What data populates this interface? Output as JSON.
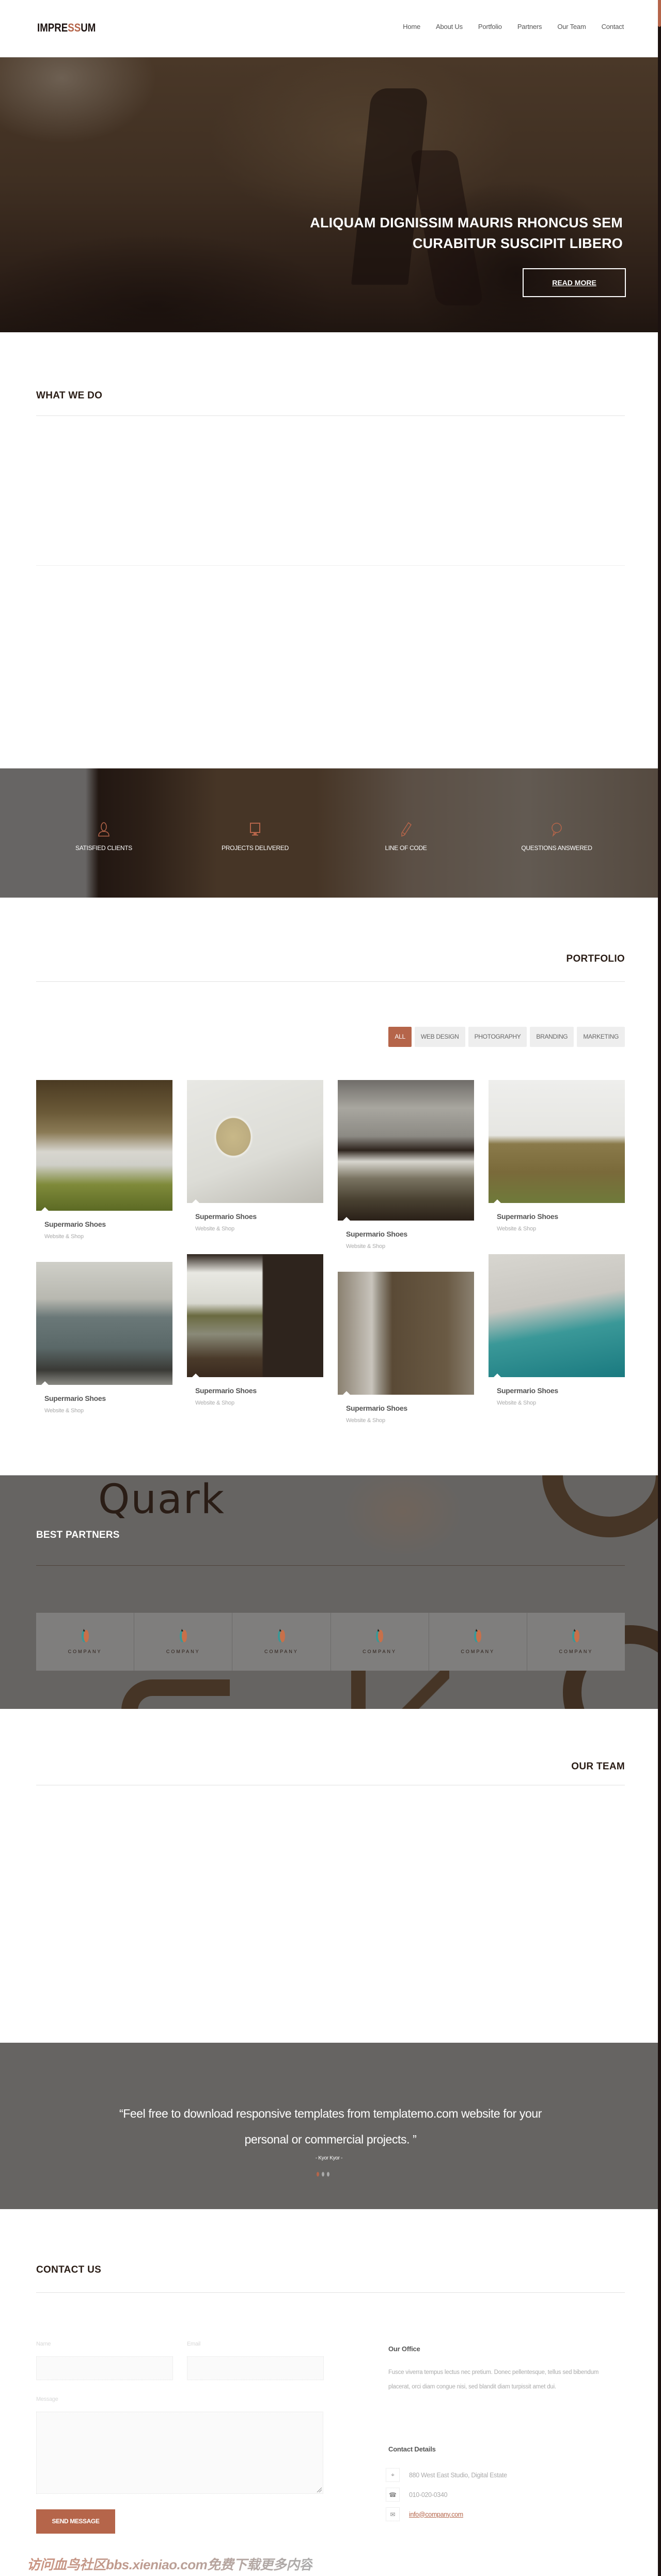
{
  "header": {
    "logo_prefix": "IMPRE",
    "logo_accent": "SS",
    "logo_suffix": "UM",
    "nav": [
      "Home",
      "About Us",
      "Portfolio",
      "Partners",
      "Our Team",
      "Contact"
    ]
  },
  "hero": {
    "title_line1": "ALIQUAM DIGNISSIM MAURIS RHONCUS SEM",
    "title_line2": "CURABITUR SUSCIPIT LIBERO",
    "button": "READ MORE",
    "prev_icon": "arrow-left-icon",
    "next_icon": "arrow-right-icon"
  },
  "what_we_do": {
    "title": "WHAT WE DO"
  },
  "stats": [
    {
      "icon": "user-icon",
      "label": "SATISFIED CLIENTS"
    },
    {
      "icon": "monitor-icon",
      "label": "PROJECTS DELIVERED"
    },
    {
      "icon": "pencil-icon",
      "label": "LINE OF CODE"
    },
    {
      "icon": "speech-bubble-icon",
      "label": "QUESTIONS ANSWERED"
    }
  ],
  "portfolio": {
    "title": "PORTFOLIO",
    "filters": [
      "ALL",
      "WEB DESIGN",
      "PHOTOGRAPHY",
      "BRANDING",
      "MARKETING"
    ],
    "active_filter": "ALL",
    "items": [
      {
        "title": "Supermario Shoes",
        "subtitle": "Website & Shop",
        "image": "wooden pier in grass"
      },
      {
        "title": "Supermario Shoes",
        "subtitle": "Website & Shop",
        "image": "hand holding coffee cup"
      },
      {
        "title": "Supermario Shoes",
        "subtitle": "Website & Shop",
        "image": "old car with snow"
      },
      {
        "title": "Supermario Shoes",
        "subtitle": "Website & Shop",
        "image": "white chair in dunes"
      },
      {
        "title": "Supermario Shoes",
        "subtitle": "Website & Shop",
        "image": "vintage van"
      },
      {
        "title": "Supermario Shoes",
        "subtitle": "Website & Shop",
        "image": "shelter by water"
      },
      {
        "title": "Supermario Shoes",
        "subtitle": "Website & Shop",
        "image": "coffee cup and pastry box"
      },
      {
        "title": "Supermario Shoes",
        "subtitle": "Website & Shop",
        "image": "cable car over sea"
      }
    ]
  },
  "partners": {
    "title": "BEST PARTNERS",
    "background_text": "Quark",
    "logos": [
      "COMPANY",
      "COMPANY",
      "COMPANY",
      "COMPANY",
      "COMPANY",
      "COMPANY"
    ]
  },
  "team": {
    "title": "OUR TEAM"
  },
  "testimonial": {
    "quote_line1": "“Feel free to download responsive templates from templatemo.com website for your",
    "quote_line2": "personal or commercial projects. ”",
    "author": "- Kyor Kyor -",
    "dots": 3,
    "active_dot": 0
  },
  "contact": {
    "title": "CONTACT US",
    "form": {
      "name_label": "Name",
      "name_value": "",
      "email_label": "Email",
      "email_value": "",
      "message_label": "Message",
      "message_value": "",
      "submit": "SEND MESSAGE"
    },
    "office": {
      "title": "Our Office",
      "text": "Fusce viverra tempus lectus nec pretium. Donec pellentesque, tellus sed bibendum placerat, orci diam congue nisi, sed blandit diam turpissit amet dui."
    },
    "details": {
      "title": "Contact Details",
      "address": "880 West East Studio, Digital Estate",
      "phone": "010-020-0340",
      "email": "info@company.com"
    }
  },
  "watermark": "访问血鸟社区bbs.xieniao.com免费下载更多内容",
  "colors": {
    "accent": "#b5654a",
    "dark": "#2a1d16",
    "band_gray": "#666462"
  }
}
